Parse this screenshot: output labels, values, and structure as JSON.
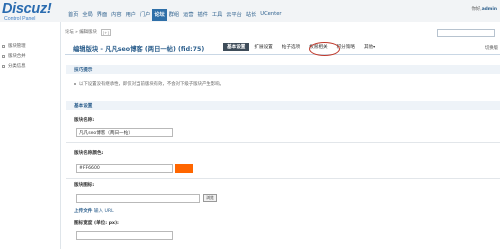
{
  "logo": {
    "text": "Discuz!",
    "sub": "Control Panel"
  },
  "nav_tabs": [
    "首页",
    "全局",
    "界面",
    "内容",
    "用户",
    "门户",
    "论坛",
    "群组",
    "运营",
    "插件",
    "工具",
    "云平台",
    "站长",
    "UCenter"
  ],
  "active_tab_index": 6,
  "user": {
    "greeting": "你好,",
    "name": "admin"
  },
  "sidebar": {
    "items": [
      "版块管理",
      "版块合并",
      "分类信息"
    ]
  },
  "breadcrumb": {
    "text": "论坛 » 编辑版块",
    "plus": "[+]"
  },
  "page": {
    "title": "编辑版块 - 凡凡seo博客 (两日一帖) (fid:75)",
    "right_link": "切换版"
  },
  "sub_tabs": [
    {
      "label": "基本设置",
      "active": true
    },
    {
      "label": "扩展设置",
      "active": false
    },
    {
      "label": "帖子选项",
      "active": false
    },
    {
      "label": "权限相关",
      "active": false
    },
    {
      "label": "积分策略",
      "active": false
    },
    {
      "label": "其他",
      "active": false,
      "caret": "▾"
    }
  ],
  "tips": {
    "heading": "技巧提示",
    "items": [
      "以下设置没有继承性，即仅对当前版块有效，不会对下级子版块产生影响。"
    ]
  },
  "basic": {
    "heading": "基本设置",
    "name_label": "版块名称:",
    "name_value": "凡凡seo博客（两日一帖）",
    "color_label": "版块名称颜色:",
    "color_value": "#FF6600",
    "icon_label": "版块图标:",
    "browse_label": "浏览",
    "upload": {
      "t1": "上传文件",
      "t2": "输入",
      "t3": "URL"
    },
    "width_label": "图标宽度 (单位: px):"
  },
  "colors": {
    "accent": "#2f6fa8",
    "title": "#2b5e8c",
    "swatch": "#FF6600",
    "annotation": "#c0392b"
  }
}
